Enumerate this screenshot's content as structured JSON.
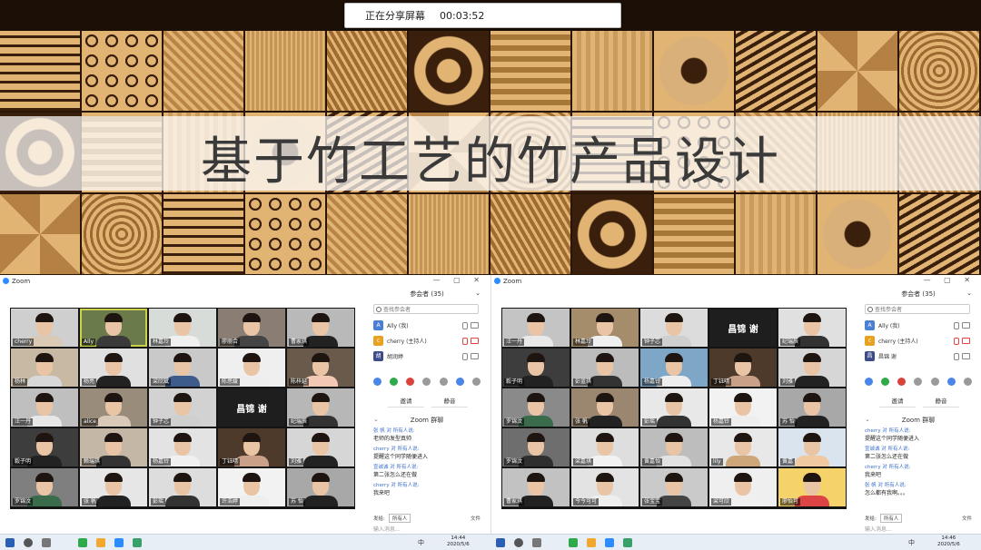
{
  "share_bar": {
    "status": "正在分享屏幕",
    "time": "00:03:52"
  },
  "slide": {
    "title": "基于竹工艺的竹产品设计"
  },
  "colors": {
    "zoom_blue": "#2d8cff",
    "gallery_bg": "#141414",
    "active_outline": "#c9d04a",
    "muted_red": "#e0443e",
    "bamboo_light": "#e2b473",
    "bamboo_dark": "#3a1f0c"
  },
  "left": {
    "window_title": "Zoom",
    "participants_header": "参会者 (35)",
    "search_placeholder": "查找参会者",
    "participants": [
      {
        "initial": "A",
        "name": "Ally (我)",
        "color": "#4a7fd6",
        "muted": false,
        "video_off": false
      },
      {
        "initial": "c",
        "name": "cherry (主持人)",
        "color": "#e8a21f",
        "muted": true,
        "video_off": true
      },
      {
        "initial": "胡",
        "name": "胡润婷",
        "color": "#3c4b8a",
        "muted": false,
        "video_off": false
      }
    ],
    "invite_label": "邀请",
    "mute_all_label": "静音",
    "chat_title": "Zoom 群聊",
    "messages": [
      {
        "from": "张 帆 对 所有人说:",
        "text": "老师的发型真帅"
      },
      {
        "from": "cherry 对 所有人说:",
        "text": "提醒这个同学随便进入"
      },
      {
        "from": "宣诚诚 对 所有人说:",
        "text": "第二张怎么还在做"
      },
      {
        "from": "cherry 对 所有人说:",
        "text": "我来吧"
      }
    ],
    "send_to_label": "发给:",
    "send_to_value": "所有人",
    "file_label": "文件",
    "input_placeholder": "输入消息...",
    "gallery": [
      {
        "name": "cherry",
        "type": "video",
        "shirt": "#d9c9b5",
        "bg": "#cfcfcf"
      },
      {
        "name": "Ally",
        "type": "video",
        "shirt": "#3a3a3a",
        "bg": "#6b7a4a",
        "active": true
      },
      {
        "name": "林嘉玲",
        "type": "video",
        "shirt": "#f0f0f0",
        "bg": "#d8dcd8"
      },
      {
        "name": "廖丽合",
        "type": "video",
        "shirt": "#444",
        "bg": "#8a7e74"
      },
      {
        "name": "曹家琪",
        "type": "video",
        "shirt": "#222",
        "bg": "#b9b9b9"
      },
      {
        "name": "杨林",
        "type": "video",
        "shirt": "#d8d8d8",
        "bg": "#c7b9a4"
      },
      {
        "name": "杨亮",
        "type": "video",
        "shirt": "#222",
        "bg": "#e0e0e0"
      },
      {
        "name": "梁欣斌",
        "type": "video",
        "shirt": "#3d5c8c",
        "bg": "#c9c9c9"
      },
      {
        "name": "陈思媛",
        "type": "video",
        "shirt": "#eee",
        "bg": "#efefef"
      },
      {
        "name": "陈梓延",
        "type": "video",
        "shirt": "#f2c9b5",
        "bg": "#6a5a4c"
      },
      {
        "name": "汪一丹",
        "type": "video",
        "shirt": "#e7e7e7",
        "bg": "#bfbfbf"
      },
      {
        "name": "alice",
        "type": "video",
        "shirt": "#d8c9b8",
        "bg": "#9a8c7a"
      },
      {
        "name": "钟子芯",
        "type": "video",
        "shirt": "#cfcfcf",
        "bg": "#d2d2d2"
      },
      {
        "name": "昌锦 谢",
        "type": "name"
      },
      {
        "name": "纪瑞辰",
        "type": "video",
        "shirt": "#333",
        "bg": "#b7b7b7"
      },
      {
        "name": "毅子明",
        "type": "video",
        "shirt": "#222",
        "bg": "#3d3d3d"
      },
      {
        "name": "赖瑞琪",
        "type": "video",
        "shirt": "#333",
        "bg": "#c5b7a6"
      },
      {
        "name": "杨嘉铃",
        "type": "video",
        "shirt": "#f0f0f0",
        "bg": "#e3e3e3"
      },
      {
        "name": "丁钰晴",
        "type": "video",
        "shirt": "#c9a088",
        "bg": "#4e3a2a"
      },
      {
        "name": "刘雅",
        "type": "video",
        "shirt": "#222",
        "bg": "#d6d6d6"
      },
      {
        "name": "罗锦汶",
        "type": "video",
        "shirt": "#3a6b4a",
        "bg": "#7f7f7f"
      },
      {
        "name": "张 帆",
        "type": "video",
        "shirt": "#222",
        "bg": "#e6e6e6"
      },
      {
        "name": "彭瑶",
        "type": "video",
        "shirt": "#333",
        "bg": "#dddddd"
      },
      {
        "name": "许浩婷",
        "type": "video",
        "shirt": "#eee",
        "bg": "#f2f2f2"
      },
      {
        "name": "苏 怡",
        "type": "video",
        "shirt": "#222",
        "bg": "#a8a8a8"
      }
    ],
    "clock_time": "14:44",
    "clock_date": "2020/5/6",
    "tray_text": "中"
  },
  "right": {
    "window_title": "Zoom",
    "participants_header": "参会者 (35)",
    "search_placeholder": "查找参会者",
    "participants": [
      {
        "initial": "A",
        "name": "Ally (我)",
        "color": "#4a7fd6",
        "muted": false,
        "video_off": false
      },
      {
        "initial": "c",
        "name": "cherry (主持人)",
        "color": "#e8a21f",
        "muted": true,
        "video_off": true
      },
      {
        "initial": "昌",
        "name": "昌锦 谢",
        "color": "#3c4b8a",
        "muted": false,
        "video_off": false
      }
    ],
    "invite_label": "邀请",
    "mute_all_label": "静音",
    "chat_title": "Zoom 群聊",
    "messages": [
      {
        "from": "cherry 对 所有人说:",
        "text": "提醒这个同学随便进入"
      },
      {
        "from": "宣诚诚 对 所有人说:",
        "text": "第二张怎么还在做"
      },
      {
        "from": "cherry 对 所有人说:",
        "text": "我来吧"
      },
      {
        "from": "张 帆 对 所有人说:",
        "text": "怎么都有我啊。。。"
      }
    ],
    "send_to_label": "发给:",
    "send_to_value": "所有人",
    "file_label": "文件",
    "input_placeholder": "输入消息...",
    "gallery": [
      {
        "name": "汪一丹",
        "type": "video",
        "shirt": "#e8e8e8",
        "bg": "#c4c4c4"
      },
      {
        "name": "林嘉玲",
        "type": "video",
        "shirt": "#f0f0f0",
        "bg": "#a58c6a"
      },
      {
        "name": "钟子芯",
        "type": "video",
        "shirt": "#cfcfcf",
        "bg": "#dcdcdc"
      },
      {
        "name": "昌锦 谢",
        "type": "name"
      },
      {
        "name": "纪瑞辰",
        "type": "video",
        "shirt": "#333",
        "bg": "#e0e0e0"
      },
      {
        "name": "毅子明",
        "type": "video",
        "shirt": "#222",
        "bg": "#3d3d3d"
      },
      {
        "name": "彭蓝琪",
        "type": "video",
        "shirt": "#333",
        "bg": "#bcbcbc"
      },
      {
        "name": "杨嘉铃",
        "type": "video",
        "shirt": "#eeeeee",
        "bg": "#7ea6c7"
      },
      {
        "name": "丁钰晴",
        "type": "video",
        "shirt": "#c9a088",
        "bg": "#4e3a2a"
      },
      {
        "name": "刘雅",
        "type": "video",
        "shirt": "#222",
        "bg": "#d6d6d6"
      },
      {
        "name": "罗锦汶",
        "type": "video",
        "shirt": "#3a6b4a",
        "bg": "#8a8a8a"
      },
      {
        "name": "张 帆",
        "type": "video",
        "shirt": "#222",
        "bg": "#9b8770"
      },
      {
        "name": "彭瑶",
        "type": "video",
        "shirt": "#333",
        "bg": "#e8e8e8"
      },
      {
        "name": "杨嘉铃",
        "type": "video",
        "shirt": "#eee",
        "bg": "#f2f2f2"
      },
      {
        "name": "苏 怡",
        "type": "video",
        "shirt": "#222",
        "bg": "#a8a8a8"
      },
      {
        "name": "罗锦汶",
        "type": "video",
        "shirt": "#2f2f2f",
        "bg": "#6e6e6e"
      },
      {
        "name": "梁嘉琪",
        "type": "video",
        "shirt": "#f2f2f2",
        "bg": "#dedede"
      },
      {
        "name": "黄嘉怡",
        "type": "video",
        "shirt": "#e2e2e2",
        "bg": "#bdbdbd"
      },
      {
        "name": "lily",
        "type": "video",
        "shirt": "#cda67a",
        "bg": "#e8e8e8"
      },
      {
        "name": "黄嘉",
        "type": "video",
        "shirt": "#f0c9a0",
        "bg": "#d9e4ef"
      },
      {
        "name": "曹家琪",
        "type": "video",
        "shirt": "#222",
        "bg": "#c2c2c2"
      },
      {
        "name": "今今可可",
        "type": "video",
        "shirt": "#eee",
        "bg": "#e3e3e3"
      },
      {
        "name": "张宝宝",
        "type": "video",
        "shirt": "#444",
        "bg": "#cacaca"
      },
      {
        "name": "梁可欣",
        "type": "video",
        "shirt": "#f0f0f0",
        "bg": "#efefef"
      },
      {
        "name": "廖怡可",
        "type": "video",
        "shirt": "#d44",
        "bg": "#f6d36a"
      }
    ],
    "clock_time": "14:46",
    "clock_date": "2020/5/6",
    "tray_text": "中"
  }
}
